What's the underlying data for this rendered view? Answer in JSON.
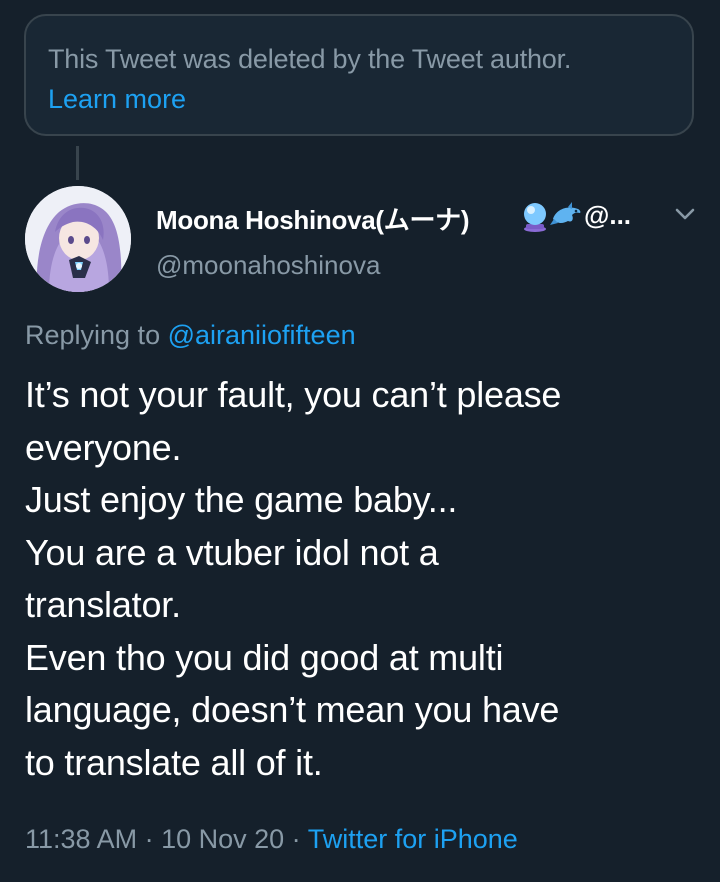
{
  "deleted_notice": {
    "message": "This Tweet was deleted by the Tweet author.",
    "learn_more": "Learn more"
  },
  "author": {
    "display_name": "Moona Hoshinova(ムーナ)",
    "name_emojis": [
      "crystal-ball-emoji",
      "dolphin-emoji"
    ],
    "name_overflow": "@...",
    "handle": "@moonahoshinova"
  },
  "reply": {
    "prefix": "Replying to ",
    "mention": "@airaniiofifteen"
  },
  "tweet": {
    "lines": [
      "It’s not your fault, you can’t please",
      "everyone.",
      "Just enjoy the game baby...",
      "You are a vtuber idol not a",
      "translator.",
      "Even tho you did good at multi",
      "language, doesn’t mean you have",
      "to translate all of it."
    ]
  },
  "meta": {
    "time": "11:38 AM",
    "separator": " · ",
    "date": "10 Nov 20",
    "source": "Twitter for iPhone"
  },
  "colors": {
    "background": "#15202b",
    "card": "#192734",
    "border": "#38444d",
    "secondary_text": "#8899a6",
    "accent": "#1da1f2"
  }
}
